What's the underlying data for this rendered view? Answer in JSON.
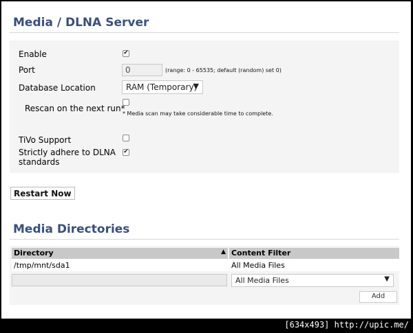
{
  "media_section": {
    "title": "Media / DLNA Server",
    "enable_label": "Enable",
    "enable_checked": true,
    "port_label": "Port",
    "port_value": "0",
    "port_hint": "(range: 0 - 65535; default (random) set 0)",
    "db_label": "Database Location",
    "db_value": "RAM (Temporary)",
    "rescan_label": "Rescan on the next run*",
    "rescan_checked": false,
    "rescan_hint": "* Media scan may take considerable time to complete.",
    "tivo_label": "TiVo Support",
    "tivo_checked": false,
    "strict_label_line1": "Strictly adhere to DLNA",
    "strict_label_line2": "standards",
    "strict_checked": true
  },
  "restart_button": "Restart Now",
  "directories_section": {
    "title": "Media Directories",
    "columns": [
      "Directory",
      "Content Filter"
    ],
    "sort_icon": "sort-up-icon",
    "rows": [
      {
        "directory": "/tmp/mnt/sda1",
        "filter": "All Media Files"
      }
    ],
    "new_directory_value": "",
    "new_filter_value": "All Media Files",
    "add_button": "Add"
  },
  "watermark": "[634x493] http://upic.me/"
}
